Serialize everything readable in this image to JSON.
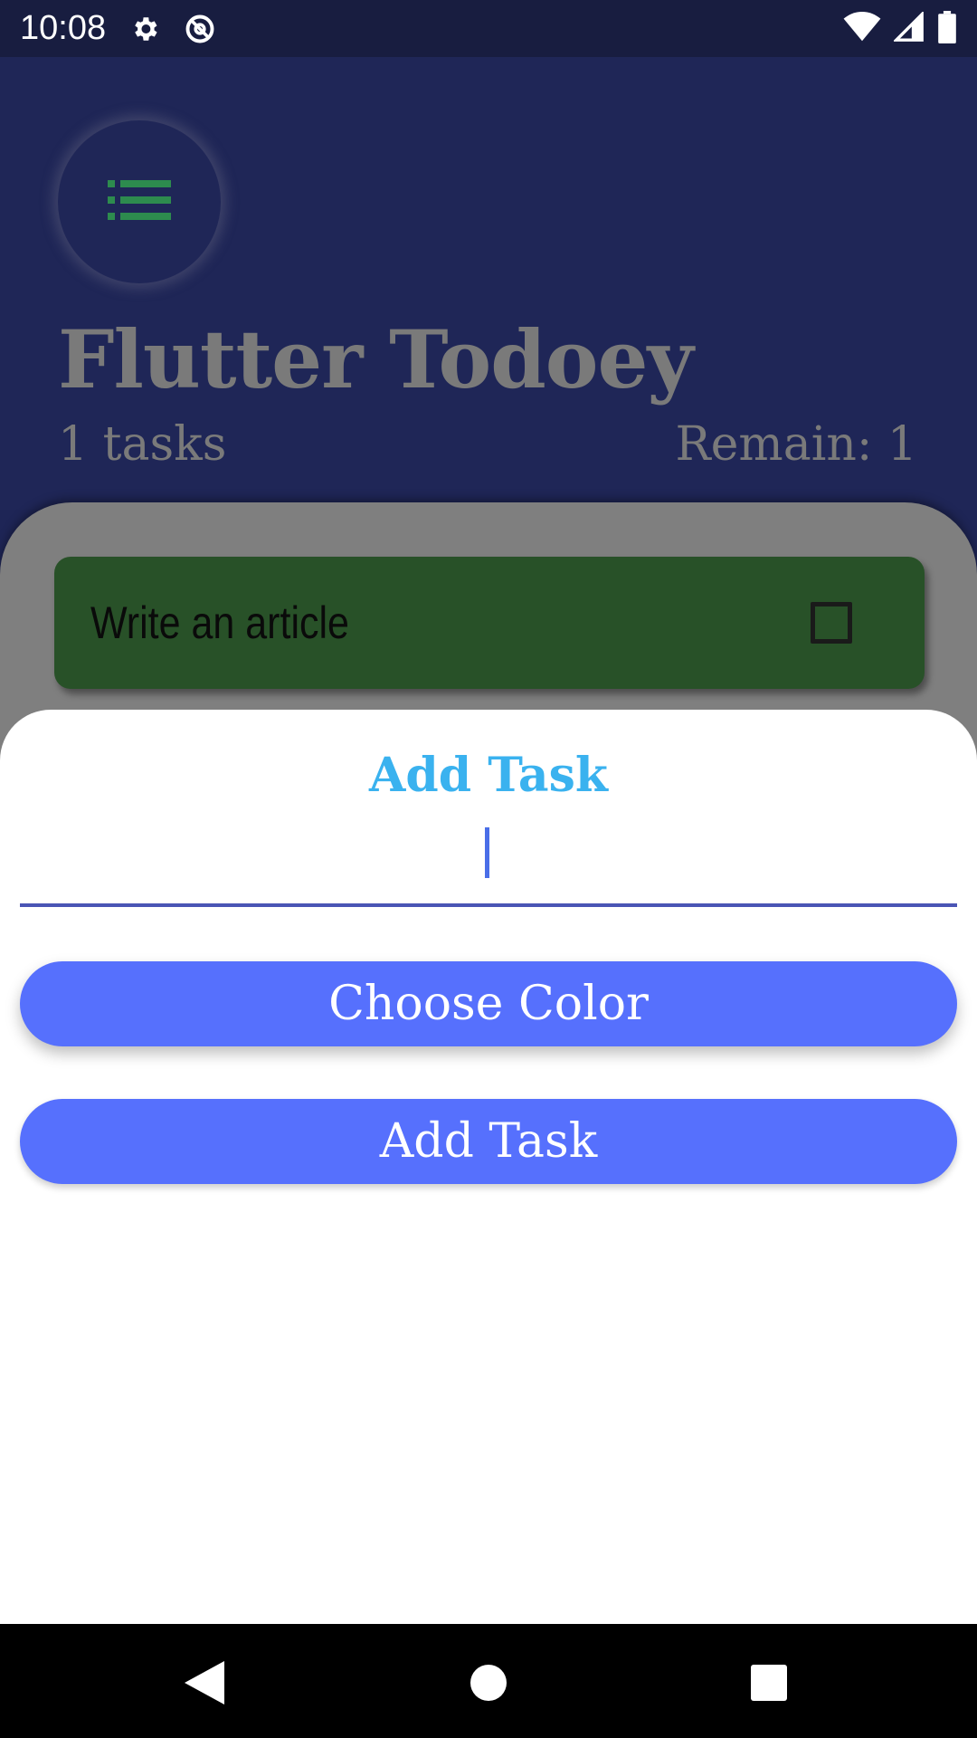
{
  "status_bar": {
    "time": "10:08",
    "icons": [
      "settings-icon",
      "at-icon",
      "wifi-icon",
      "signal-icon",
      "battery-icon"
    ]
  },
  "header": {
    "menu_icon": "list-icon",
    "title": "Flutter Todoey",
    "task_count": "1 tasks",
    "remain": "Remain: 1"
  },
  "tasks": [
    {
      "label": "Write an article",
      "checked": false,
      "color": "#285128"
    }
  ],
  "sheet": {
    "title": "Add Task",
    "input_value": "",
    "choose_color_label": "Choose Color",
    "add_task_label": "Add Task"
  },
  "nav_bar": {
    "icons": [
      "back-icon",
      "home-icon",
      "recents-icon"
    ]
  },
  "colors": {
    "accent": "#5670fd",
    "title_accent": "#3ab2ef",
    "header_bg": "#1f2657"
  }
}
